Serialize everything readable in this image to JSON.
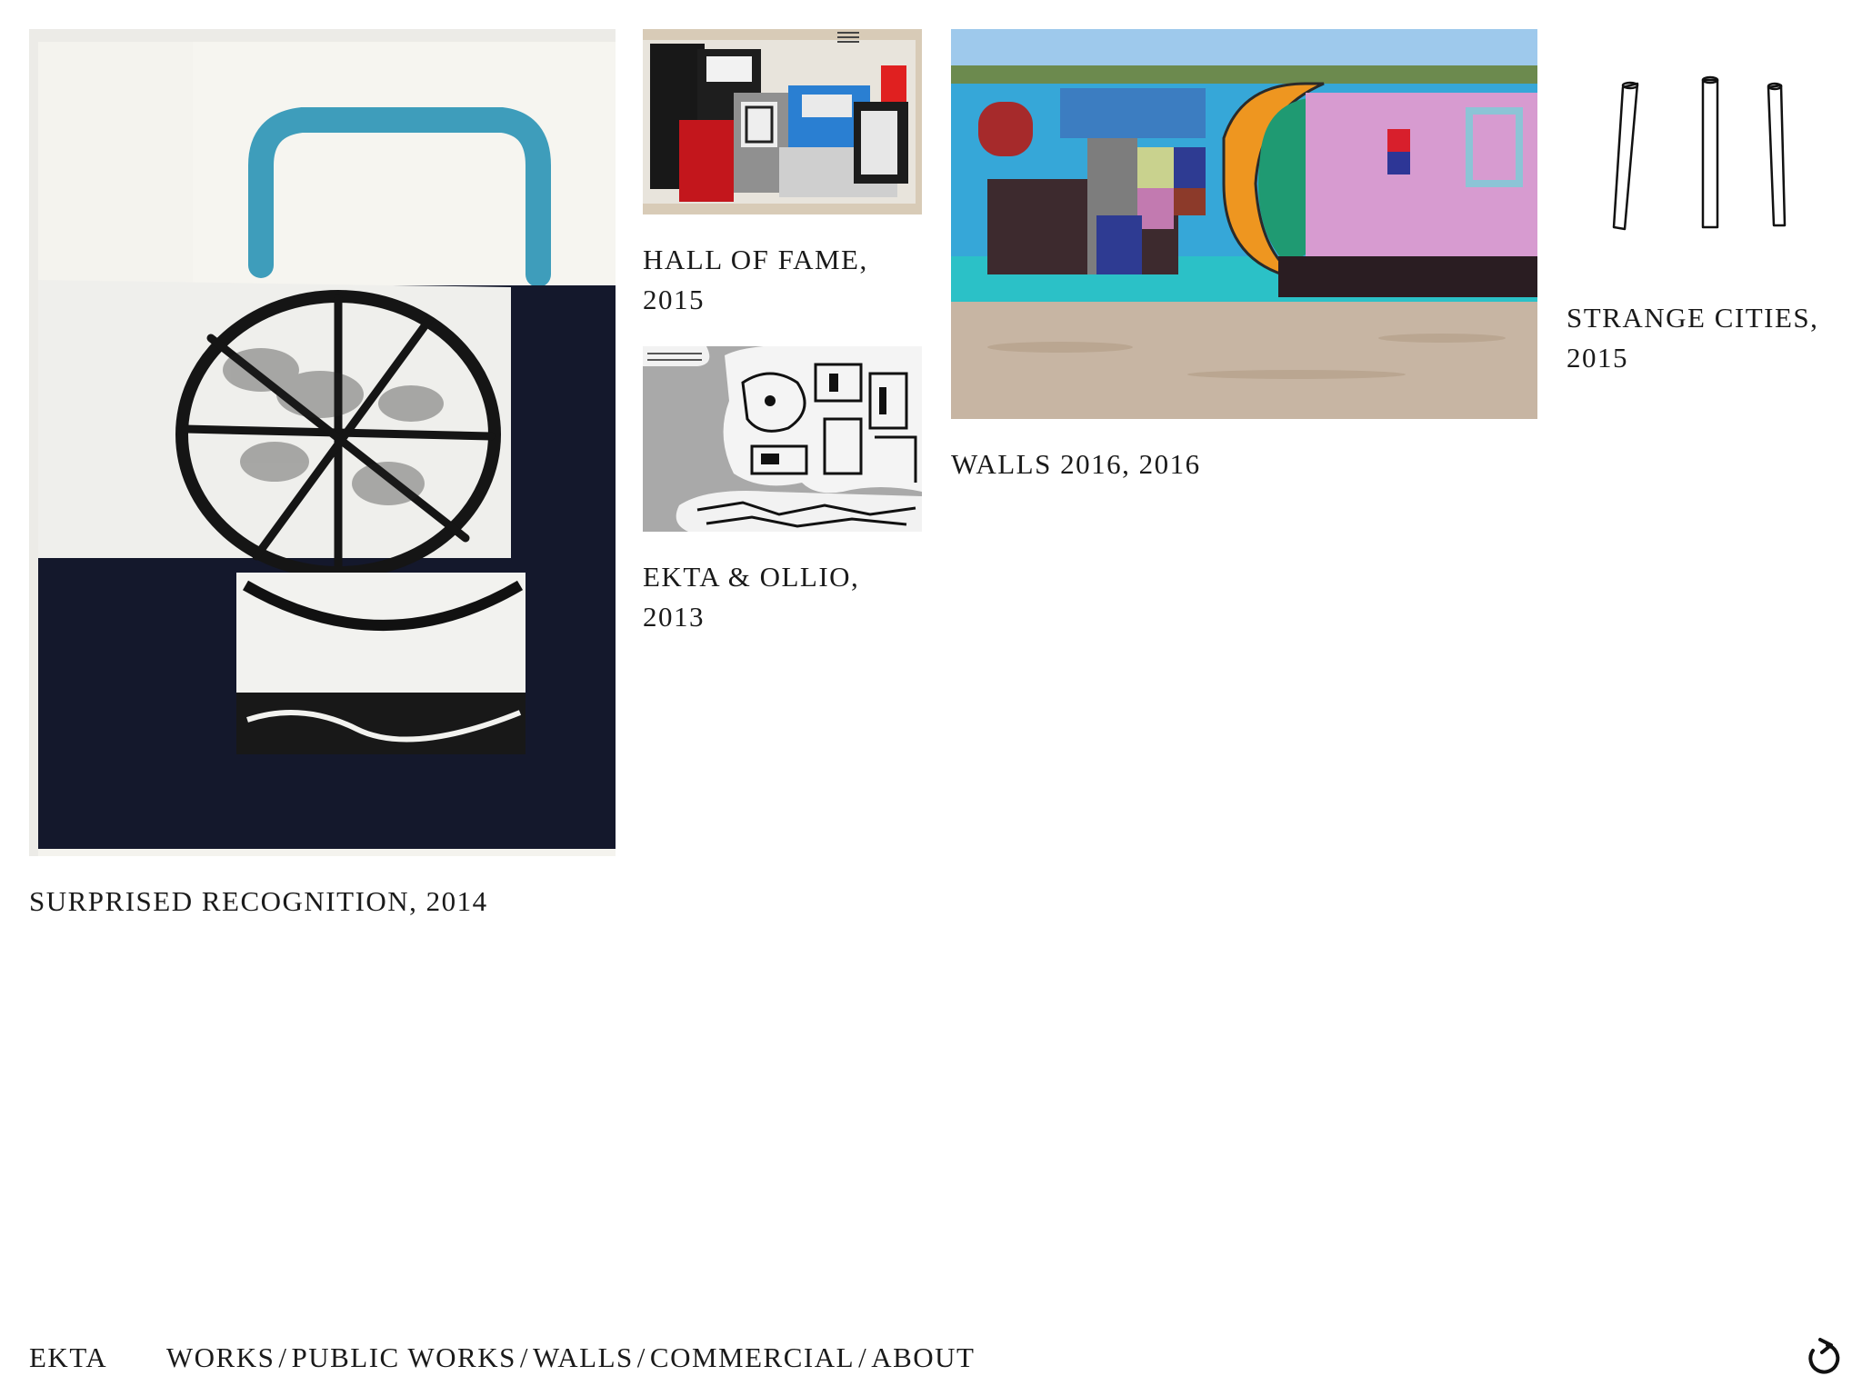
{
  "works": [
    {
      "title": "SURPRISED RECOGNITION, 2014",
      "lines": [
        "SURPRISED RECOGNITION, 2014"
      ]
    },
    {
      "title": "HALL OF FAME, 2015",
      "lines": [
        "HALL OF FAME,",
        "2015"
      ]
    },
    {
      "title": "EKTA & OLLIO, 2013",
      "lines": [
        "EKTA & OLLIO,",
        "2013"
      ]
    },
    {
      "title": "WALLS 2016, 2016",
      "lines": [
        "WALLS 2016, 2016"
      ]
    },
    {
      "title": "STRANGE CITIES, 2015",
      "lines": [
        "STRANGE CITIES,",
        "2015"
      ]
    }
  ],
  "footer": {
    "brand": "EKTA",
    "nav": [
      "WORKS",
      "PUBLIC WORKS",
      "WALLS",
      "COMMERCIAL",
      "ABOUT"
    ],
    "separator": "/"
  },
  "icons": {
    "reload": "reload-icon"
  },
  "colors": {
    "text": "#1a1a1a",
    "background": "#ffffff"
  }
}
